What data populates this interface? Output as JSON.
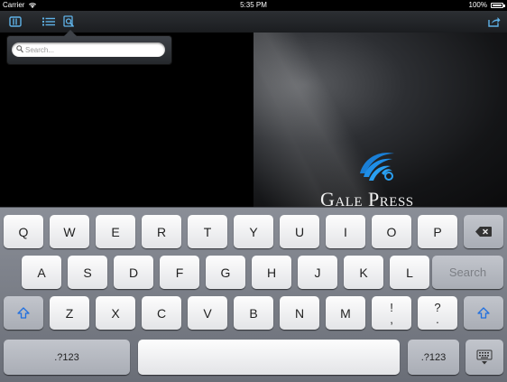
{
  "status_bar": {
    "carrier": "Carrier",
    "time": "5:35 PM",
    "battery": "100%",
    "wifi_icon": "wifi-icon",
    "battery_icon": "battery-icon"
  },
  "toolbar": {
    "library_icon": "library-icon",
    "list_icon": "list-icon",
    "search_icon": "search-document-icon",
    "share_icon": "share-icon"
  },
  "search": {
    "placeholder": "Search...",
    "value": ""
  },
  "cover": {
    "brand": "Gale Press"
  },
  "keyboard": {
    "row1": [
      "Q",
      "W",
      "E",
      "R",
      "T",
      "Y",
      "U",
      "I",
      "O",
      "P"
    ],
    "row2": [
      "A",
      "S",
      "D",
      "F",
      "G",
      "H",
      "J",
      "K",
      "L"
    ],
    "row3": [
      "Z",
      "X",
      "C",
      "V",
      "B",
      "N",
      "M"
    ],
    "punct1": [
      "!",
      ","
    ],
    "punct2": [
      "?",
      "."
    ],
    "search_key": "Search",
    "numbers_left": ".?123",
    "numbers_right": ".?123"
  }
}
